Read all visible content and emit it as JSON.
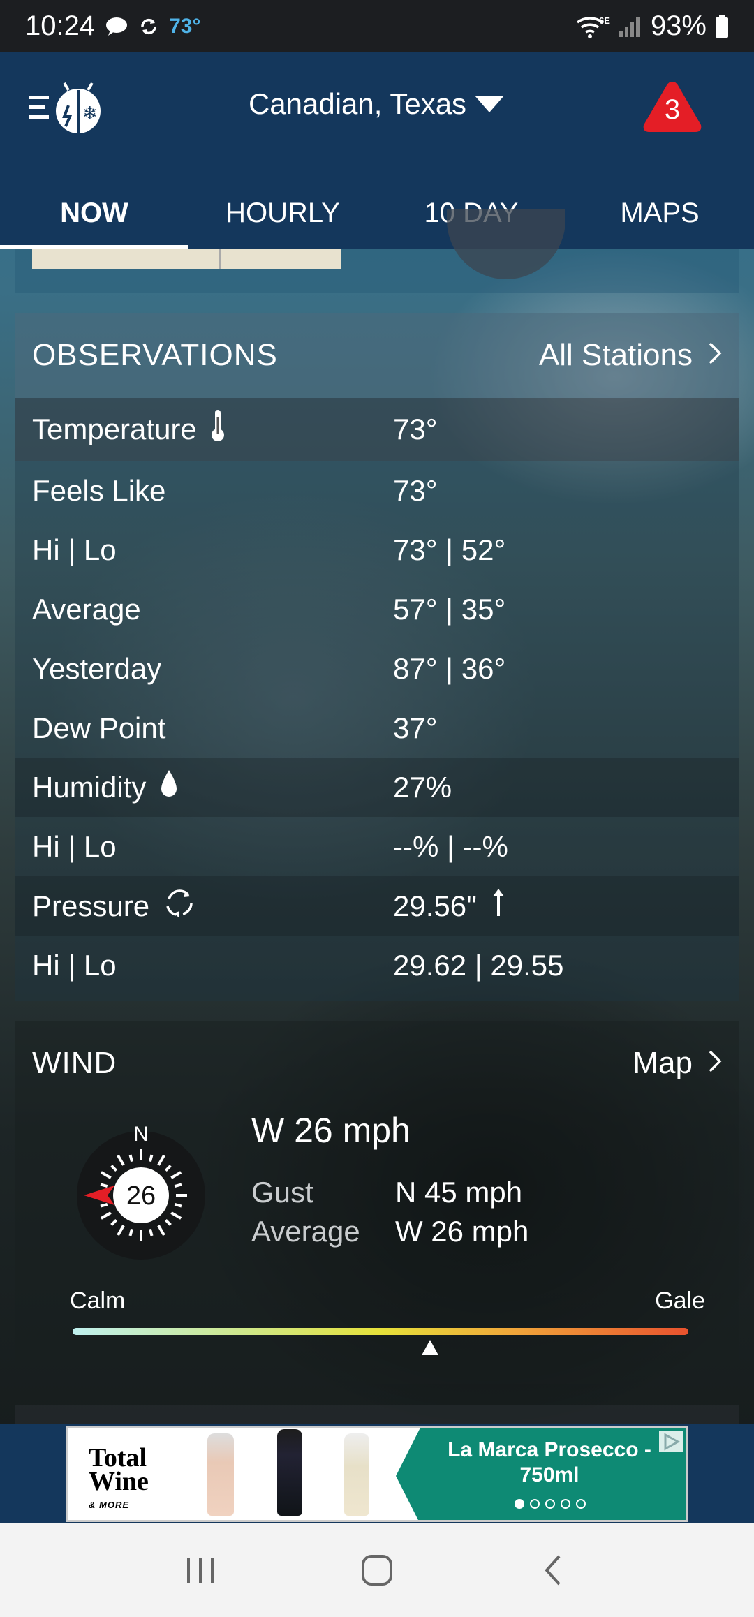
{
  "status_bar": {
    "time": "10:24",
    "temp": "73°",
    "battery": "93%",
    "network": "6E"
  },
  "header": {
    "location": "Canadian, Texas",
    "alert_count": "3"
  },
  "tabs": [
    {
      "label": "NOW",
      "active": true
    },
    {
      "label": "HOURLY",
      "active": false
    },
    {
      "label": "10 DAY",
      "active": false
    },
    {
      "label": "MAPS",
      "active": false
    }
  ],
  "observations": {
    "title": "OBSERVATIONS",
    "link": "All Stations",
    "rows": [
      {
        "label": "Temperature",
        "value": "73°",
        "icon": "thermometer-icon"
      },
      {
        "label": "Feels Like",
        "value": "73°"
      },
      {
        "label": "Hi | Lo",
        "value": "73° | 52°"
      },
      {
        "label": "Average",
        "value": "57° | 35°"
      },
      {
        "label": "Yesterday",
        "value": "87° | 36°"
      },
      {
        "label": "Dew Point",
        "value": "37°"
      },
      {
        "label": "Humidity",
        "value": "27%",
        "icon": "droplet-icon"
      },
      {
        "label": "Hi | Lo",
        "value": "--% | --%"
      },
      {
        "label": "Pressure",
        "value": "29.56\"",
        "icon": "pressure-cycle-icon",
        "trend": "up"
      },
      {
        "label": "Hi | Lo",
        "value": "29.62 | 29.55"
      }
    ]
  },
  "wind": {
    "title": "WIND",
    "link": "Map",
    "compass_speed": "26",
    "compass_north": "N",
    "summary": "W 26 mph",
    "gust_label": "Gust",
    "gust_value": "N 45 mph",
    "average_label": "Average",
    "average_value": "W 26 mph",
    "scale_min_label": "Calm",
    "scale_max_label": "Gale",
    "scale_level": 0.58
  },
  "ad": {
    "brand_line1": "Total",
    "brand_line2": "Wine",
    "brand_line3": "& MORE",
    "headline": "La Marca Prosecco - 750ml",
    "slides": 5,
    "active_slide": 0
  },
  "colors": {
    "header_bg": "#14375c",
    "alert_red": "#e41e26",
    "status_temp": "#4fb3e8",
    "ad_green": "#0e8a74"
  }
}
